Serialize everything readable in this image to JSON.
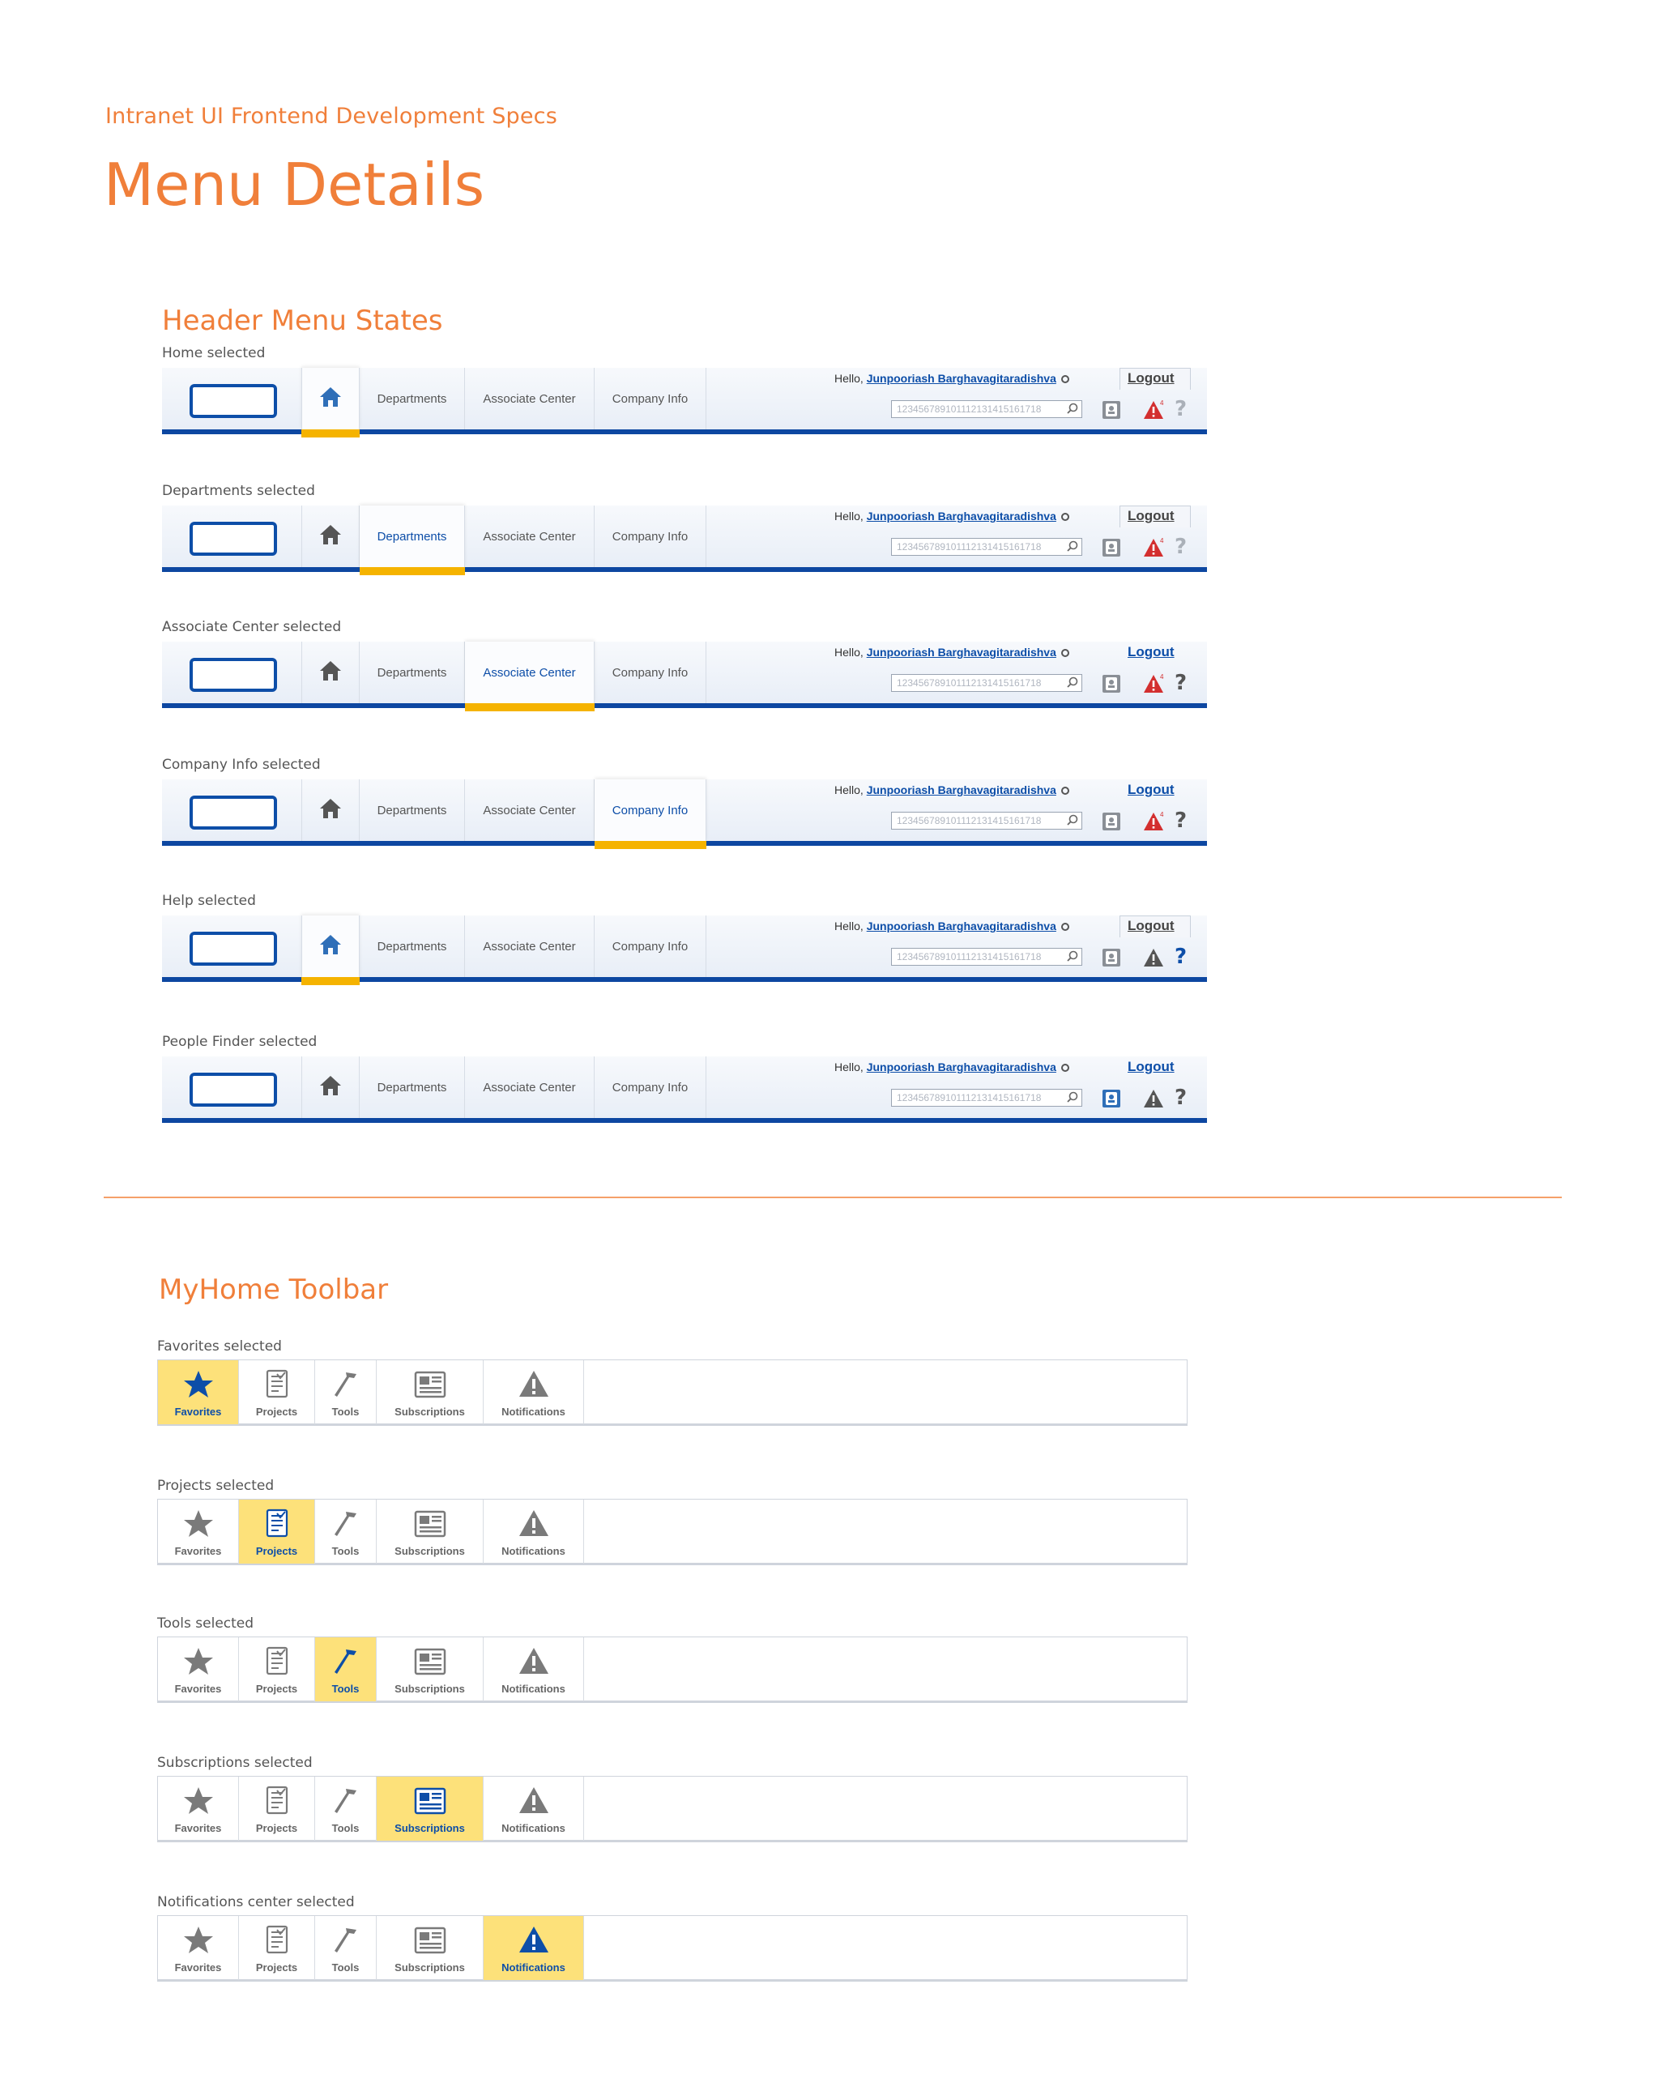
{
  "doc": {
    "subtitle": "Intranet UI Frontend Development Specs",
    "title": "Menu Details"
  },
  "header_section": {
    "title": "Header Menu States",
    "nav": {
      "departments": "Departments",
      "associate_center": "Associate Center",
      "company_info": "Company Info"
    },
    "user": {
      "hello": "Hello, ",
      "name": "Junpooriash Barghavagitaradishva",
      "logout": "Logout",
      "search_placeholder": "123456789101112131415161718"
    },
    "states": [
      {
        "label": "Home selected",
        "selected": "home"
      },
      {
        "label": "Departments selected",
        "selected": "departments"
      },
      {
        "label": "Associate Center selected",
        "selected": "associate_center"
      },
      {
        "label": "Company Info selected",
        "selected": "company_info"
      },
      {
        "label": "Help selected",
        "selected": "help"
      },
      {
        "label": "People Finder selected",
        "selected": "people_finder"
      }
    ]
  },
  "toolbar_section": {
    "title": "MyHome Toolbar",
    "items": {
      "favorites": "Favorites",
      "projects": "Projects",
      "tools": "Tools",
      "subscriptions": "Subscriptions",
      "notifications": "Notifications"
    },
    "states": [
      {
        "label": "Favorites selected",
        "selected": "favorites"
      },
      {
        "label": "Projects selected",
        "selected": "projects"
      },
      {
        "label": "Tools selected",
        "selected": "tools"
      },
      {
        "label": "Subscriptions selected",
        "selected": "subscriptions"
      },
      {
        "label": "Notifications center selected",
        "selected": "notifications"
      }
    ]
  },
  "colors": {
    "accent_orange": "#f07f3a",
    "brand_blue": "#0d47a1",
    "selection_yellow": "#f5b300",
    "toolbar_selected": "#fde17a",
    "alert_red": "#d32f2f"
  }
}
